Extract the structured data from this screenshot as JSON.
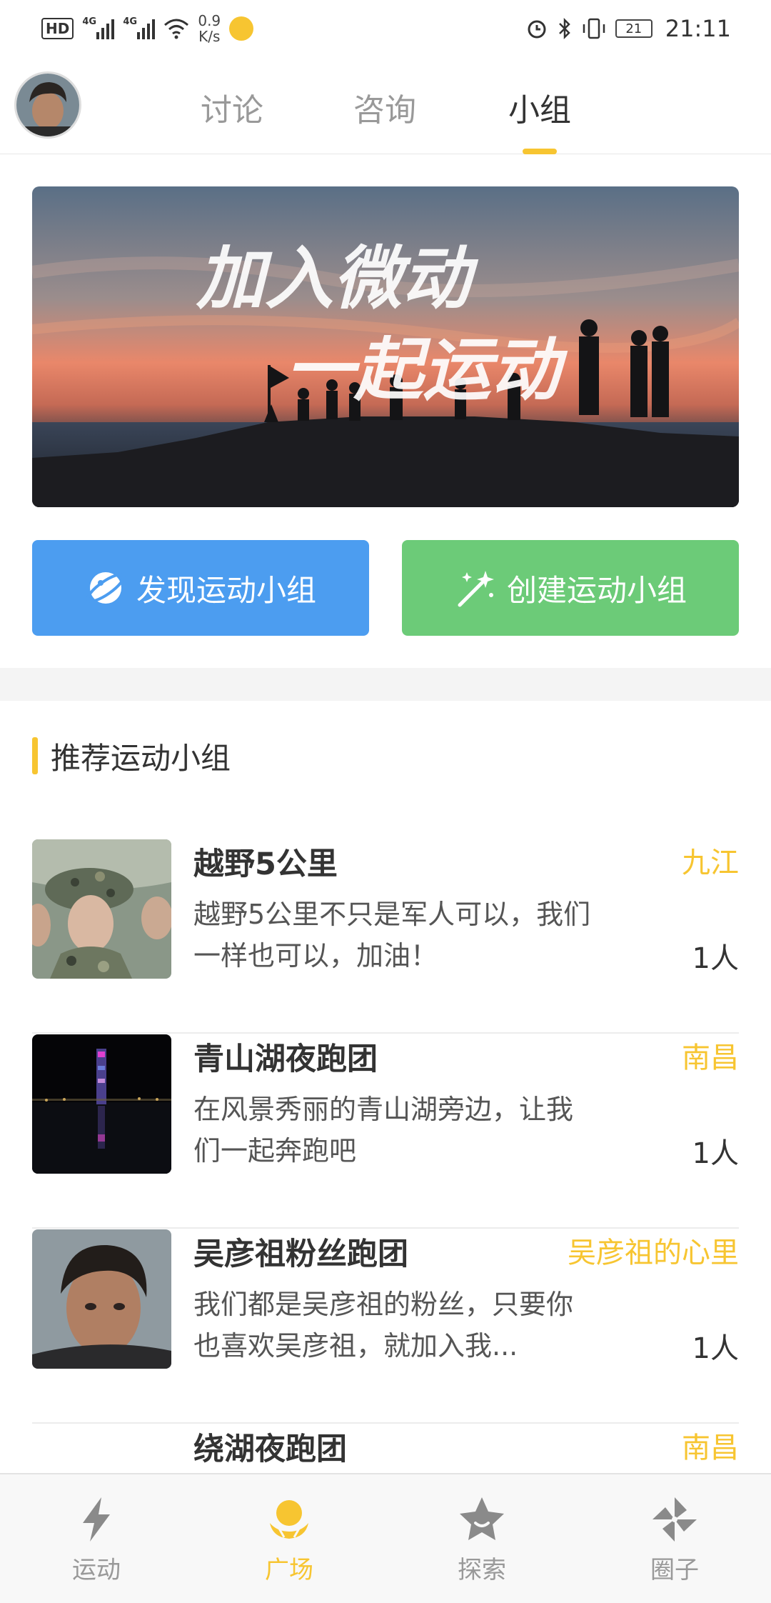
{
  "status_bar": {
    "hd": "HD",
    "net1": "4G",
    "net2": "4G",
    "speed_value": "0.9",
    "speed_unit": "K/s",
    "battery": "21",
    "time": "21:11"
  },
  "header": {
    "tabs": [
      {
        "label": "讨论"
      },
      {
        "label": "咨询"
      },
      {
        "label": "小组"
      }
    ],
    "active_tab": "小组"
  },
  "banner": {
    "line1": "加入微动",
    "line2": "一起运动"
  },
  "actions": {
    "discover_label": "发现运动小组",
    "create_label": "创建运动小组"
  },
  "section": {
    "title": "推荐运动小组"
  },
  "groups": [
    {
      "name": "越野5公里",
      "city": "九江",
      "desc": "越野5公里不只是军人可以，我们一样也可以，加油！",
      "count": "1人"
    },
    {
      "name": "青山湖夜跑团",
      "city": "南昌",
      "desc": "在风景秀丽的青山湖旁边，让我们一起奔跑吧",
      "count": "1人"
    },
    {
      "name": "吴彦祖粉丝跑团",
      "city": "吴彦祖的心里",
      "desc": "我们都是吴彦祖的粉丝，只要你也喜欢吴彦祖，就加入我...",
      "count": "1人"
    },
    {
      "name": "绕湖夜跑团",
      "city": "南昌",
      "desc": "",
      "count": ""
    }
  ],
  "bottom_nav": [
    {
      "label": "运动",
      "icon": "lightning-icon"
    },
    {
      "label": "广场",
      "icon": "plaza-icon"
    },
    {
      "label": "探索",
      "icon": "star-icon"
    },
    {
      "label": "圈子",
      "icon": "pinwheel-icon"
    }
  ],
  "colors": {
    "accent": "#f7c531",
    "discover": "#4c9df0",
    "create": "#6ccb78"
  }
}
